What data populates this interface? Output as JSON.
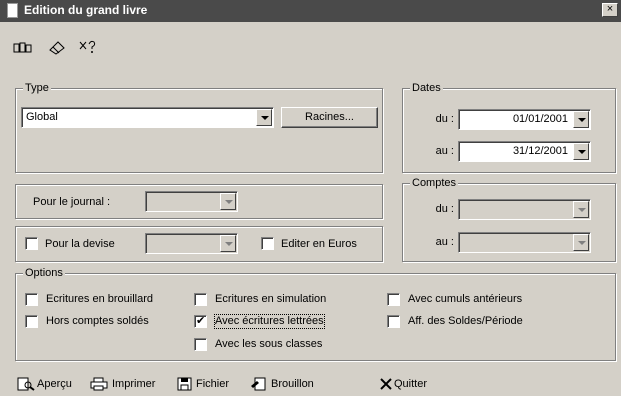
{
  "window": {
    "title": "Edition du grand livre",
    "close": "×"
  },
  "toolbar": {
    "icons": [
      "books-icon",
      "eraser-icon",
      "help-icon"
    ]
  },
  "type_group": {
    "legend": "Type",
    "value": "Global",
    "racines_label": "Racines..."
  },
  "dates_group": {
    "legend": "Dates",
    "du_label": "du :",
    "du_value": "01/01/2001",
    "au_label": "au :",
    "au_value": "31/12/2001"
  },
  "journal": {
    "label": "Pour le journal :"
  },
  "devise": {
    "label": "Pour la devise",
    "euros_label": "Editer en Euros"
  },
  "comptes_group": {
    "legend": "Comptes",
    "du_label": "du :",
    "au_label": "au :"
  },
  "options_group": {
    "legend": "Options",
    "ecritures_brouillard": "Ecritures en brouillard",
    "hors_comptes_soldes": "Hors comptes soldés",
    "ecritures_simulation": "Ecritures en simulation",
    "avec_ecritures_lettrees": "Avec écritures lettrées",
    "avec_sous_classes": "Avec les sous classes",
    "avec_cumuls": "Avec cumuls antérieurs",
    "aff_soldes": "Aff. des Soldes/Période"
  },
  "actions": {
    "apercu": "Aperçu",
    "imprimer": "Imprimer",
    "fichier": "Fichier",
    "brouillon": "Brouillon",
    "quitter": "Quitter"
  }
}
